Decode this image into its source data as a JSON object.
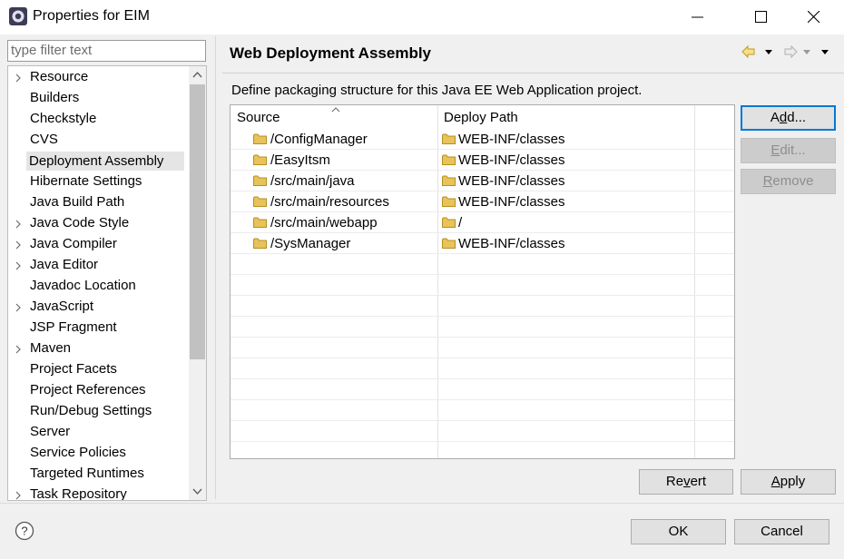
{
  "window": {
    "title": "Properties for EIM"
  },
  "filter": {
    "placeholder": "type filter text"
  },
  "tree": [
    {
      "label": "Resource",
      "expandable": true
    },
    {
      "label": "Builders",
      "expandable": false
    },
    {
      "label": "Checkstyle",
      "expandable": false
    },
    {
      "label": "CVS",
      "expandable": false
    },
    {
      "label": "Deployment Assembly",
      "expandable": false,
      "selected": true
    },
    {
      "label": "Hibernate Settings",
      "expandable": false
    },
    {
      "label": "Java Build Path",
      "expandable": false
    },
    {
      "label": "Java Code Style",
      "expandable": true
    },
    {
      "label": "Java Compiler",
      "expandable": true
    },
    {
      "label": "Java Editor",
      "expandable": true
    },
    {
      "label": "Javadoc Location",
      "expandable": false
    },
    {
      "label": "JavaScript",
      "expandable": true
    },
    {
      "label": "JSP Fragment",
      "expandable": false
    },
    {
      "label": "Maven",
      "expandable": true
    },
    {
      "label": "Project Facets",
      "expandable": false
    },
    {
      "label": "Project References",
      "expandable": false
    },
    {
      "label": "Run/Debug Settings",
      "expandable": false
    },
    {
      "label": "Server",
      "expandable": false
    },
    {
      "label": "Service Policies",
      "expandable": false
    },
    {
      "label": "Targeted Runtimes",
      "expandable": false
    },
    {
      "label": "Task Repository",
      "expandable": true
    }
  ],
  "page": {
    "title": "Web Deployment Assembly",
    "description": "Define packaging structure for this Java EE Web Application project."
  },
  "table": {
    "headers": {
      "source": "Source",
      "deploy_path": "Deploy Path"
    },
    "rows": [
      {
        "source": "/ConfigManager",
        "deploy_path": "WEB-INF/classes"
      },
      {
        "source": "/EasyItsm",
        "deploy_path": "WEB-INF/classes"
      },
      {
        "source": "/src/main/java",
        "deploy_path": "WEB-INF/classes"
      },
      {
        "source": "/src/main/resources",
        "deploy_path": "WEB-INF/classes"
      },
      {
        "source": "/src/main/webapp",
        "deploy_path": "/"
      },
      {
        "source": "/SysManager",
        "deploy_path": "WEB-INF/classes"
      }
    ]
  },
  "buttons": {
    "add_pre": "A",
    "add_u": "d",
    "add_post": "d...",
    "edit_u": "E",
    "edit_post": "dit...",
    "remove_u": "R",
    "remove_post": "emove",
    "revert_pre": "Re",
    "revert_u": "v",
    "revert_post": "ert",
    "apply_u": "A",
    "apply_post": "pply",
    "ok": "OK",
    "cancel": "Cancel"
  },
  "colors": {
    "accent": "#0078d7",
    "selection": "#e5e5e5",
    "folder": "#e8c25a"
  }
}
